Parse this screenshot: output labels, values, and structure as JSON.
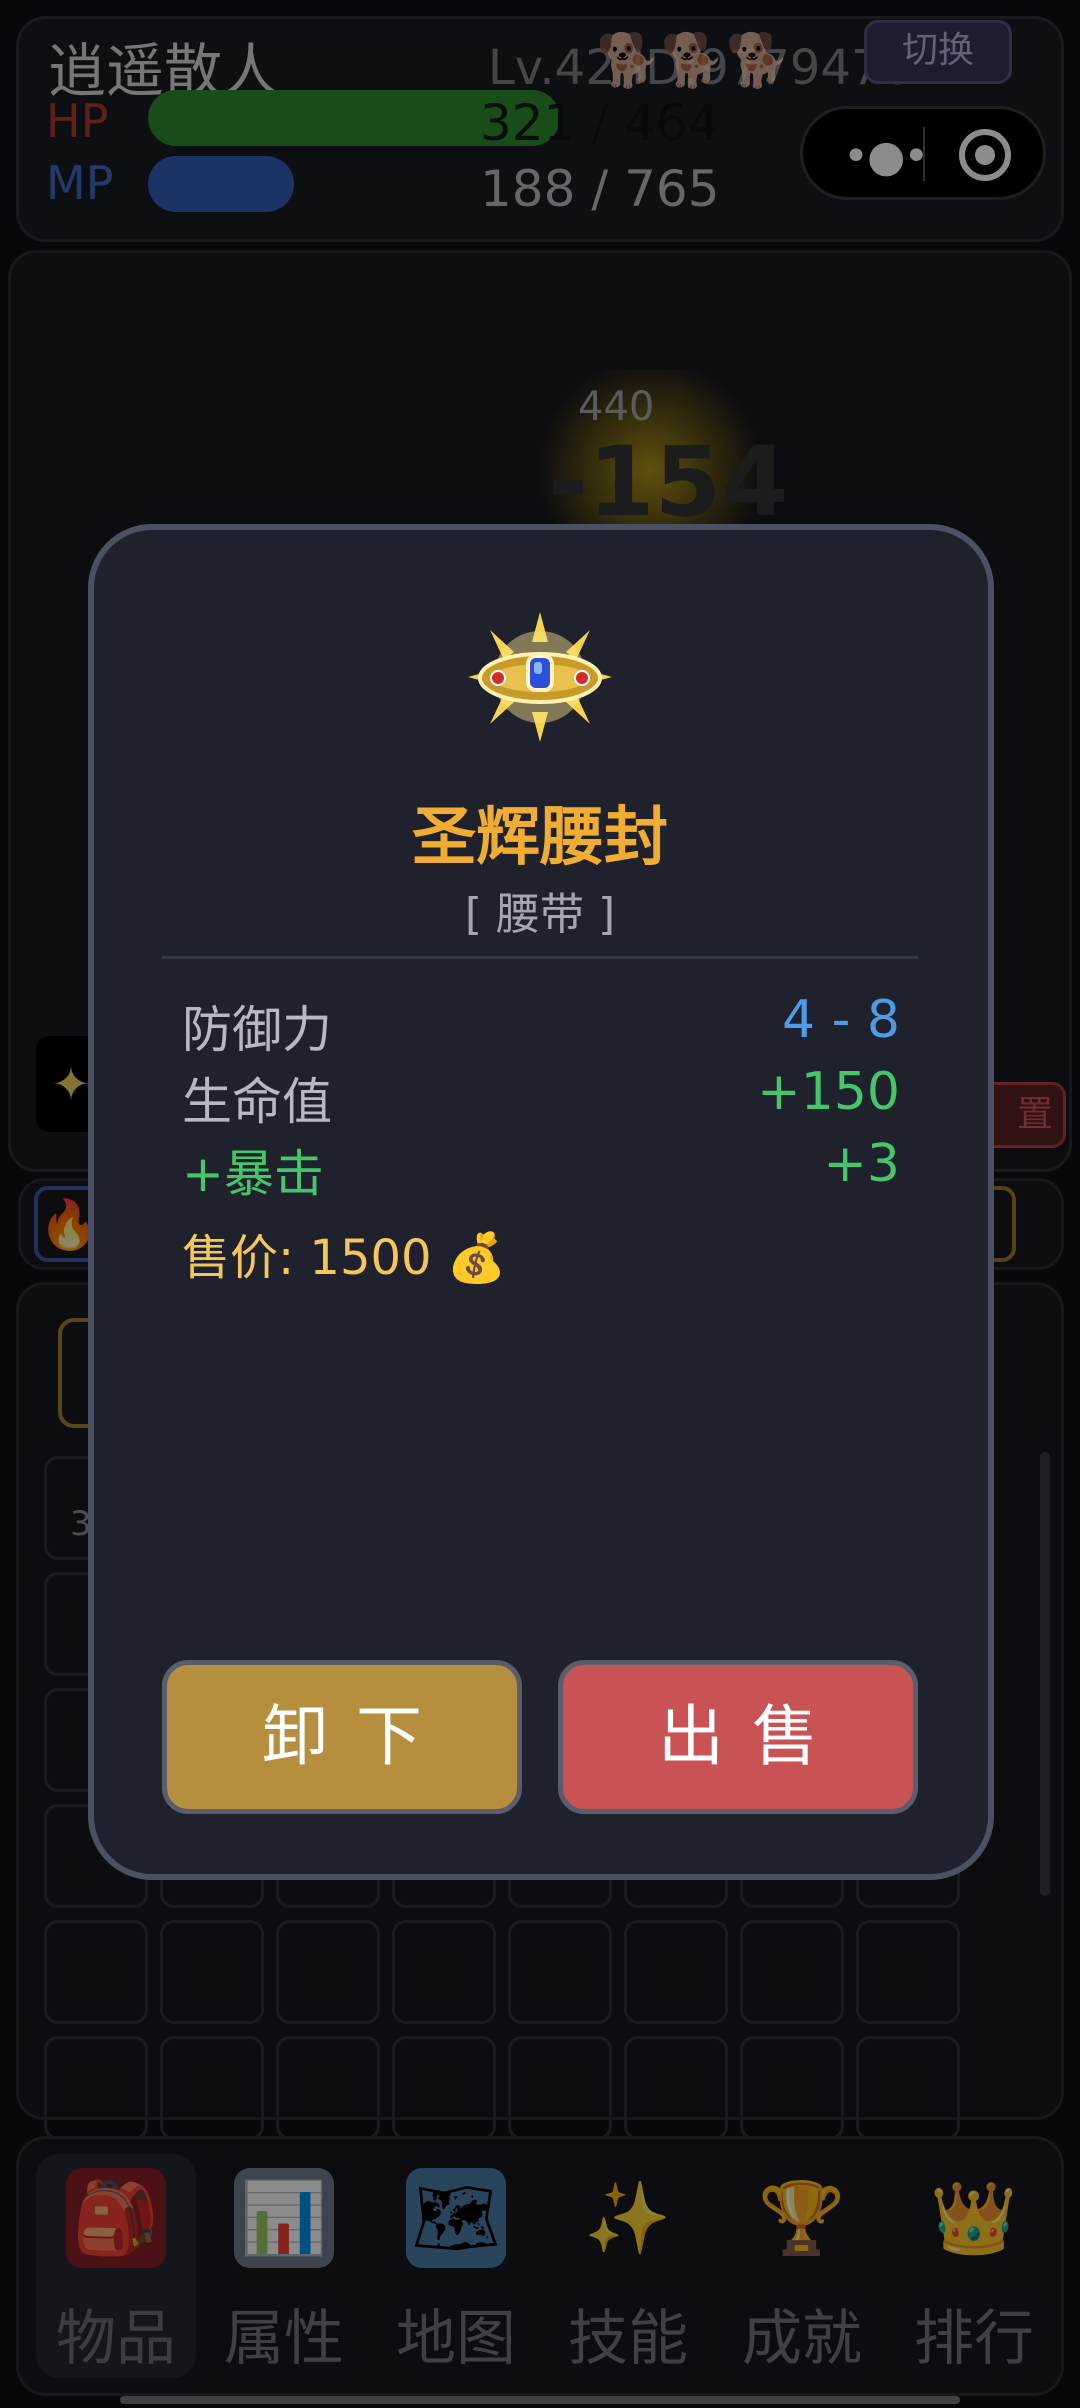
{
  "player": {
    "name": "逍遥散人",
    "level_id": "Lv.42 ID:97794701",
    "pets": "🐕🐕🐕",
    "switch_label": "切换",
    "hp_label": "HP",
    "hp_text": "321 / 464",
    "hp_current": 321,
    "hp_max": 464,
    "mp_label": "MP",
    "mp_text": "188 / 765",
    "mp_current": 188,
    "mp_max": 765
  },
  "battle": {
    "damage_max": "440",
    "damage_value": "-154",
    "reset_label": "置"
  },
  "inventory": {
    "count_text": "3"
  },
  "modal": {
    "item_name": "圣辉腰封",
    "item_type": "[ 腰带 ]",
    "stats": [
      {
        "label": "防御力",
        "value": "4 - 8",
        "color": "#4f9be8"
      },
      {
        "label": "生命值",
        "value": "+150",
        "color": "#44c768"
      },
      {
        "label": "+暴击",
        "value": "+3",
        "color": "#44c768"
      }
    ],
    "price_text": "售价: 1500 💰",
    "unequip_label": "卸下",
    "sell_label": "出售"
  },
  "nav": [
    {
      "label": "物品",
      "icon": "backpack-icon",
      "glyph": "🎒"
    },
    {
      "label": "属性",
      "icon": "bar-chart-icon",
      "glyph": "📊"
    },
    {
      "label": "地图",
      "icon": "map-icon",
      "glyph": "🗺"
    },
    {
      "label": "技能",
      "icon": "sparkle-icon",
      "glyph": "✨"
    },
    {
      "label": "成就",
      "icon": "trophy-icon",
      "glyph": "🏆"
    },
    {
      "label": "排行",
      "icon": "crown-icon",
      "glyph": "👑"
    }
  ]
}
